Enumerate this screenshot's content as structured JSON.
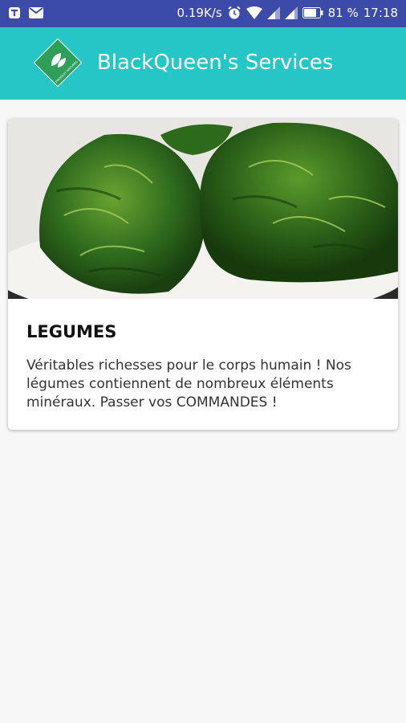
{
  "status_bar": {
    "network_speed": "0.19K/s",
    "battery": "81 %",
    "time": "17:18",
    "icons": [
      "vpn-icon",
      "mail-icon",
      "alarm-icon",
      "wifi-icon",
      "signal-icon",
      "signal-icon",
      "battery-icon"
    ]
  },
  "app_bar": {
    "title": "BlackQueen's Services",
    "logo_text": "PRODUIT NATUREL",
    "color": "#26c6c7"
  },
  "card": {
    "image": "vegetables-image",
    "title": "LEGUMES",
    "description": "Véritables richesses pour le corps humain ! Nos légumes contiennent de nombreux éléments minéraux. Passer vos COMMANDES !"
  }
}
